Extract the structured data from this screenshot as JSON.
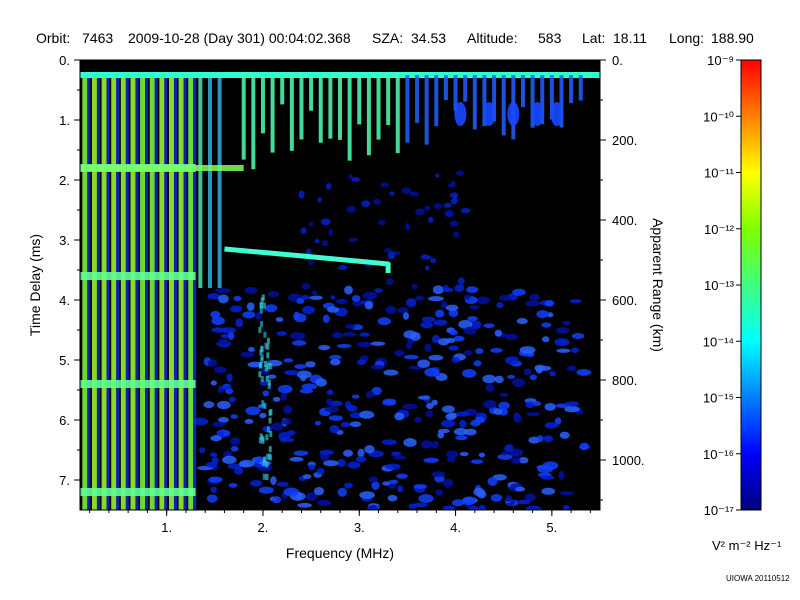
{
  "header": {
    "orbit_label": "Orbit:",
    "orbit": "7463",
    "datetime": "2009-10-28 (Day 301) 00:04:02.368",
    "sza_label": "SZA:",
    "sza": "34.53",
    "altitude_label": "Altitude:",
    "altitude": "583",
    "lat_label": "Lat:",
    "lat": "18.11",
    "long_label": "Long:",
    "long": "188.90"
  },
  "credit": "UIOWA 20110512",
  "colorbar": {
    "unit_text": "V² m⁻² Hz⁻¹",
    "tick_labels": [
      "10⁻⁹",
      "10⁻¹⁰",
      "10⁻¹¹",
      "10⁻¹²",
      "10⁻¹³",
      "10⁻¹⁴",
      "10⁻¹⁵",
      "10⁻¹⁶",
      "10⁻¹⁷"
    ],
    "log_exponent_range": [
      -17,
      -9
    ],
    "colors": [
      "#00007f",
      "#0000ff",
      "#0080ff",
      "#00ffff",
      "#40ff80",
      "#80ff00",
      "#ffff00",
      "#ff8000",
      "#ff0000"
    ]
  },
  "chart_data": {
    "type": "heatmap",
    "xlabel": "Frequency (MHz)",
    "ylabel": "Time Delay (ms)",
    "y2label": "Apparent Range (km)",
    "xlim": [
      0.1,
      5.5
    ],
    "ylim": [
      0,
      7.5
    ],
    "y2lim": [
      0,
      1125
    ],
    "x_ticks": [
      1,
      2,
      3,
      4,
      5
    ],
    "x_tick_labels": [
      "1.",
      "2.",
      "3.",
      "4.",
      "5."
    ],
    "y_ticks": [
      0,
      1,
      2,
      3,
      4,
      5,
      6,
      7
    ],
    "y_tick_labels": [
      "0.",
      "1.",
      "2.",
      "3.",
      "4.",
      "5.",
      "6.",
      "7."
    ],
    "y2_ticks": [
      0,
      200,
      400,
      600,
      800,
      1000
    ],
    "y2_tick_labels": [
      "0.",
      "200.",
      "400.",
      "600.",
      "800.",
      "1000."
    ],
    "background_color": "#000000",
    "features": {
      "surface_echo_delay": 0.25,
      "ionosphere_trace": [
        {
          "f": 1.6,
          "t": 3.15
        },
        {
          "f": 2.3,
          "t": 3.25
        },
        {
          "f": 3.3,
          "t": 3.4
        },
        {
          "f": 3.3,
          "t": 3.55
        }
      ],
      "harmonics_cutoff_mhz": 1.3,
      "harmonic_spacing_mhz": 0.1,
      "horizontal_bands_ms": [
        1.8,
        3.6,
        5.4,
        7.2
      ]
    }
  }
}
